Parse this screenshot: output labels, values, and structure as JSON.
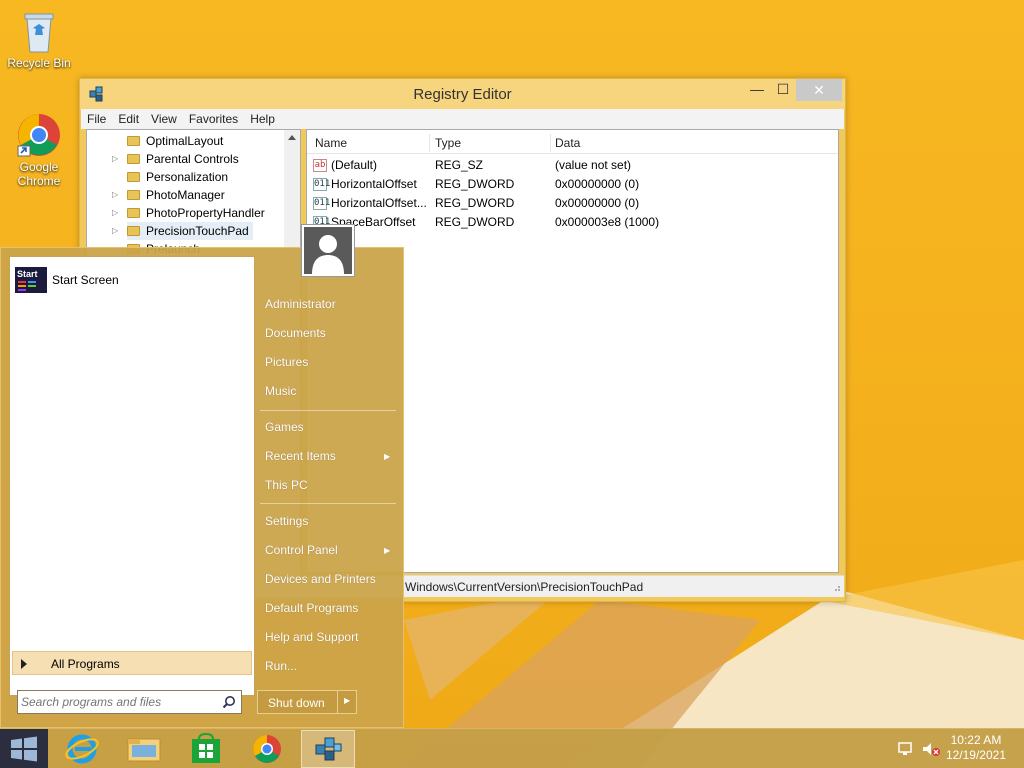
{
  "desktop": {
    "icons": [
      {
        "label": "Recycle Bin"
      },
      {
        "label": "Google Chrome"
      }
    ]
  },
  "window": {
    "title": "Registry Editor",
    "controls": {
      "minimize": "—",
      "maximize": "☐",
      "close": "✕"
    },
    "menu": [
      "File",
      "Edit",
      "View",
      "Favorites",
      "Help"
    ],
    "tree_items": [
      "OptimalLayout",
      "Parental Controls",
      "Personalization",
      "PhotoManager",
      "PhotoPropertyHandler",
      "PrecisionTouchPad",
      "Prelaunch"
    ],
    "columns": [
      "Name",
      "Type",
      "Data"
    ],
    "rows": [
      {
        "icon": "ab",
        "name": "(Default)",
        "type": "REG_SZ",
        "data": "(value not set)"
      },
      {
        "icon": "011",
        "name": "HorizontalOffset",
        "type": "REG_DWORD",
        "data": "0x00000000 (0)"
      },
      {
        "icon": "011",
        "name": "HorizontalOffset...",
        "type": "REG_DWORD",
        "data": "0x00000000 (0)"
      },
      {
        "icon": "011",
        "name": "SpaceBarOffset",
        "type": "REG_DWORD",
        "data": "0x000003e8 (1000)"
      }
    ],
    "status_path": "Windows\\CurrentVersion\\PrecisionTouchPad"
  },
  "start_menu": {
    "pinned": {
      "tile_text": "Start",
      "label": "Start Screen"
    },
    "all_programs": "All Programs",
    "search_placeholder": "Search programs and files",
    "right_items": [
      "Administrator",
      "Documents",
      "Pictures",
      "Music",
      "Games",
      "Recent Items",
      "This PC",
      "Settings",
      "Control Panel",
      "Devices and Printers",
      "Default Programs",
      "Help and Support",
      "Run..."
    ],
    "submenu_arrow": "▶",
    "shutdown_label": "Shut down",
    "shutdown_arrow": "▶"
  },
  "taskbar": {
    "apps": [
      "windows-logo-icon",
      "internet-explorer-icon",
      "file-explorer-icon",
      "store-icon",
      "chrome-icon",
      "regedit-icon"
    ],
    "clock_time": "10:22 AM",
    "clock_date": "12/19/2021"
  },
  "colors": {
    "wallpaper": "#f4b01c",
    "start_menu": "#cba449",
    "tree_folder": "#e8c35a"
  }
}
